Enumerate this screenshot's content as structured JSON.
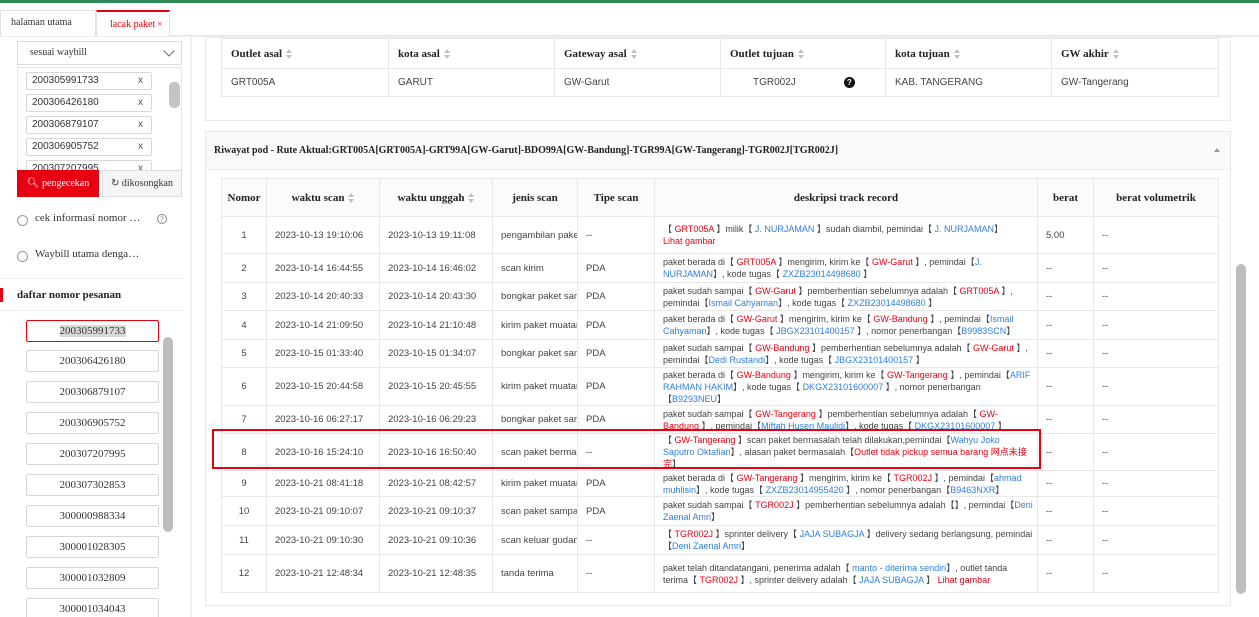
{
  "tabs": {
    "home": "halaman utama",
    "track": "lacak paket",
    "close": "×"
  },
  "sidebar": {
    "select_value": "sesuai waybill",
    "waybill_chips": [
      "200305991733",
      "200306426180",
      "200306879107",
      "200306905752",
      "200307207995"
    ],
    "chip_close": "x",
    "check_button": "pengecekan",
    "clear_button": "dikosongkan",
    "radio1": "cek informasi nomor …",
    "radio2": "Waybill utama denga…",
    "help": "?",
    "orders_title": "daftar nomor pesanan",
    "orders": [
      "200305991733",
      "200306426180",
      "200306879107",
      "200306905752",
      "200307207995",
      "200307302853",
      "300000988334",
      "300001028305",
      "300001032809",
      "300001034043"
    ]
  },
  "route": {
    "headers": [
      "Outlet asal",
      "kota asal",
      "Gateway asal",
      "Outlet tujuan",
      "kota tujuan",
      "GW akhir"
    ],
    "row": [
      "GRT005A",
      "GARUT",
      "GW-Garut",
      "TGR002J",
      "KAB. TANGERANG",
      "GW-Tangerang"
    ],
    "help": "?"
  },
  "pod": {
    "title": "Riwayat pod - Rute Aktual:GRT005A[GRT005A]-GRT99A[GW-Garut]-BDO99A[GW-Bandung]-TGR99A[GW-Tangerang]-TGR002J[TGR002J]",
    "headers": {
      "no": "Nomor",
      "scan_time": "waktu scan",
      "upload_time": "waktu unggah",
      "scan_kind": "jenis scan",
      "scan_type": "Tipe scan",
      "desc": "deskripsi track record",
      "weight": "berat",
      "vol": "berat volumetrik"
    },
    "rows": [
      {
        "no": "1",
        "scan": "2023-10-13 19:10:06",
        "upload": "2023-10-13 19:11:08",
        "kind": "pengambilan paket",
        "type": "--",
        "weight": "5.00",
        "vol": "--"
      },
      {
        "no": "2",
        "scan": "2023-10-14 16:44:55",
        "upload": "2023-10-14 16:46:02",
        "kind": "scan kirim",
        "type": "PDA",
        "weight": "--",
        "vol": "--"
      },
      {
        "no": "3",
        "scan": "2023-10-14 20:40:33",
        "upload": "2023-10-14 20:43:30",
        "kind": "bongkar paket sampai",
        "type": "PDA",
        "weight": "--",
        "vol": "--"
      },
      {
        "no": "4",
        "scan": "2023-10-14 21:09:50",
        "upload": "2023-10-14 21:10:48",
        "kind": "kirim paket muatan",
        "type": "PDA",
        "weight": "--",
        "vol": "--"
      },
      {
        "no": "5",
        "scan": "2023-10-15 01:33:40",
        "upload": "2023-10-15 01:34:07",
        "kind": "bongkar paket sampai",
        "type": "PDA",
        "weight": "--",
        "vol": "--"
      },
      {
        "no": "6",
        "scan": "2023-10-15 20:44:58",
        "upload": "2023-10-15 20:45:55",
        "kind": "kirim paket muatan",
        "type": "PDA",
        "weight": "--",
        "vol": "--"
      },
      {
        "no": "7",
        "scan": "2023-10-16 06:27:17",
        "upload": "2023-10-16 06:29:23",
        "kind": "bongkar paket sampai",
        "type": "PDA",
        "weight": "--",
        "vol": "--"
      },
      {
        "no": "8",
        "scan": "2023-10-16 15:24:10",
        "upload": "2023-10-16 16:50:40",
        "kind": "scan paket bermasalah",
        "type": "--",
        "weight": "--",
        "vol": "--"
      },
      {
        "no": "9",
        "scan": "2023-10-21 08:41:18",
        "upload": "2023-10-21 08:42:57",
        "kind": "kirim paket muatan",
        "type": "PDA",
        "weight": "--",
        "vol": "--"
      },
      {
        "no": "10",
        "scan": "2023-10-21 09:10:07",
        "upload": "2023-10-21 09:10:37",
        "kind": "scan paket sampai",
        "type": "PDA",
        "weight": "--",
        "vol": "--"
      },
      {
        "no": "11",
        "scan": "2023-10-21 09:10:30",
        "upload": "2023-10-21 09:10:36",
        "kind": "scan keluar gudang",
        "type": "--",
        "weight": "--",
        "vol": "--"
      },
      {
        "no": "12",
        "scan": "2023-10-21 12:48:34",
        "upload": "2023-10-21 12:48:35",
        "kind": "tanda terima",
        "type": "--",
        "weight": "--",
        "vol": "--"
      }
    ],
    "d1": [
      "【 ",
      "GRT005A",
      " 】milik【 ",
      "J. NURJAMAN",
      " 】sudah diambil,  pemindai【 ",
      "J. NURJAMAN",
      "】",
      "Lihat gambar"
    ],
    "d2": [
      "paket berada di【 ",
      "GRT005A",
      " 】mengirim, kirim ke【 ",
      "GW-Garut",
      " 】,  pemindai【",
      "J. NURJAMAN",
      "】,  kode tugas【 ",
      "ZXZB23014498680",
      " 】"
    ],
    "d3": [
      "paket sudah sampai【 ",
      "GW-Garut",
      " 】pemberhentian sebelumnya adalah【 ",
      "GRT005A",
      " 】,  pemindai【",
      "Ismail Cahyaman",
      "】,  kode tugas【 ",
      "ZXZB23014498680",
      " 】"
    ],
    "d4": [
      "paket berada di【 ",
      "GW-Garut",
      " 】mengirim, kirim ke【 ",
      "GW-Bandung",
      " 】,  pemindai【",
      "Ismail Cahyaman",
      "】,  kode tugas【 ",
      "JBGX23101400157",
      " 】,  nomor penerbangan【",
      "B9983SCN",
      "】"
    ],
    "d5": [
      "paket sudah sampai【 ",
      "GW-Bandung",
      " 】pemberhentian sebelumnya adalah【 ",
      "GW-Garut",
      " 】,  pemindai【",
      "Dedi Rustandi",
      "】,  kode tugas【 ",
      "JBGX23101400157",
      " 】"
    ],
    "d6": [
      "paket berada di【 ",
      "GW-Bandung",
      " 】mengirim, kirim ke【 ",
      "GW-Tangerang",
      " 】,  pemindai【",
      "ARIF RAHMAN HAKIM",
      "】,  kode tugas【 ",
      "DKGX23101600007",
      " 】,  nomor penerbangan【",
      "B9293NEU",
      "】"
    ],
    "d7": [
      "paket sudah sampai【 ",
      "GW-Tangerang",
      " 】pemberhentian sebelumnya adalah【 ",
      "GW-Bandung",
      " 】,  pemindai【",
      "Miftah Husen Maulidi",
      "】,  kode tugas【 ",
      "DKGX23101600007",
      " 】"
    ],
    "d8": [
      "【 ",
      "GW-Tangerang",
      " 】scan paket bermasalah telah dilakukan,pemindai【",
      "Wahyu Joko Saputro Oktafian",
      "】,  alasan paket bermasalah【",
      "Outlet tidak pickup semua barang 网点未接完",
      "】"
    ],
    "d9": [
      "paket berada di【 ",
      "GW-Tangerang",
      " 】mengirim, kirim ke【 ",
      "TGR002J",
      " 】,  pemindai【",
      "ahmad muhlisin",
      "】,  kode tugas【 ",
      "ZXZB23014955420",
      " 】,  nomor penerbangan【",
      "B9463NXR",
      "】"
    ],
    "d10": [
      "paket sudah sampai【 ",
      "TGR002J",
      " 】pemberhentian sebelumnya adalah【】,  pemindai【",
      "Deni Zaenal Amri",
      "】"
    ],
    "d11": [
      "【 ",
      "TGR002J",
      " 】sprinter delivery【 ",
      "JAJA SUBAGJA",
      " 】delivery sedang berlangsung, pemindai【",
      "Deni Zaenal Amri",
      "】"
    ],
    "d12": [
      "paket telah ditandatangani, penerima adalah【 ",
      "manto - diterima sendiri",
      "】,  outlet tanda terima【 ",
      "TGR002J",
      " 】,  sprinter delivery adalah【 ",
      "JAJA SUBAGJA",
      " 】",
      "Lihat gambar"
    ]
  },
  "colors": {
    "accent": "#e60012",
    "link": "#2f7fd8",
    "ok": "#2e9d2e"
  }
}
